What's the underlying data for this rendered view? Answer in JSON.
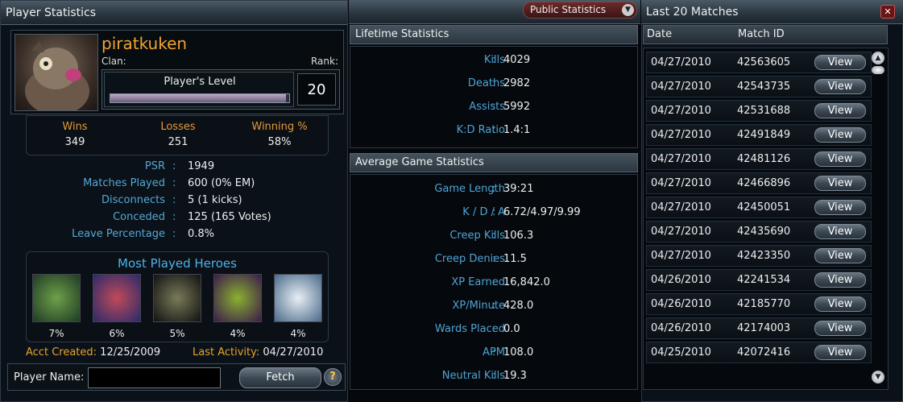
{
  "window": {
    "left_title": "Player Statistics",
    "right_title": "Last 20 Matches",
    "view_dropdown": "Public Statistics"
  },
  "player": {
    "name": "piratkuken",
    "clan_label": "Clan:",
    "rank_label": "Rank:",
    "level_label": "Player's Level",
    "level": "20",
    "level_progress": 0.98,
    "wins_label": "Wins",
    "wins": "349",
    "losses_label": "Losses",
    "losses": "251",
    "winpct_label": "Winning %",
    "winpct": "58%"
  },
  "stats": [
    {
      "label": "PSR",
      "value": "1949"
    },
    {
      "label": "Matches Played",
      "value": "600 (0% EM)"
    },
    {
      "label": "Disconnects",
      "value": "5 (1 kicks)"
    },
    {
      "label": "Conceded",
      "value": "125 (165 Votes)"
    },
    {
      "label": "Leave Percentage",
      "value": "0.8%"
    }
  ],
  "heroes": {
    "title": "Most Played Heroes",
    "items": [
      {
        "icon": "goblin-hero-portrait",
        "pct": "7%"
      },
      {
        "icon": "vampire-hero-portrait",
        "pct": "6%"
      },
      {
        "icon": "undead-hero-portrait",
        "pct": "5%"
      },
      {
        "icon": "beast-hero-portrait",
        "pct": "4%"
      },
      {
        "icon": "frost-hero-portrait",
        "pct": "4%"
      }
    ]
  },
  "account": {
    "created_label": "Acct Created:",
    "created": "12/25/2009",
    "activity_label": "Last Activity:",
    "activity": "04/27/2010"
  },
  "search": {
    "label": "Player Name:",
    "value": "",
    "fetch": "Fetch",
    "help": "?"
  },
  "lifetime": {
    "title": "Lifetime Statistics",
    "rows": [
      {
        "label": "Kills",
        "value": "4029"
      },
      {
        "label": "Deaths",
        "value": "2982"
      },
      {
        "label": "Assists",
        "value": "5992"
      },
      {
        "label": "K:D Ratio",
        "value": "1.4:1"
      }
    ]
  },
  "average": {
    "title": "Average Game Statistics",
    "rows": [
      {
        "label": "Game Length",
        "value": "39:21"
      },
      {
        "label": "K / D / A",
        "value": "6.72/4.97/9.99"
      },
      {
        "label": "Creep Kills",
        "value": "106.3"
      },
      {
        "label": "Creep Denies",
        "value": "11.5"
      },
      {
        "label": "XP Earned",
        "value": "16,842.0"
      },
      {
        "label": "XP/Minute",
        "value": "428.0"
      },
      {
        "label": "Wards Placed",
        "value": "0.0"
      },
      {
        "label": "APM",
        "value": "108.0"
      },
      {
        "label": "Neutral Kills",
        "value": "19.3"
      }
    ]
  },
  "matches": {
    "date_header": "Date",
    "id_header": "Match ID",
    "view_label": "View",
    "rows": [
      {
        "date": "04/27/2010",
        "id": "42563605"
      },
      {
        "date": "04/27/2010",
        "id": "42543735"
      },
      {
        "date": "04/27/2010",
        "id": "42531688"
      },
      {
        "date": "04/27/2010",
        "id": "42491849"
      },
      {
        "date": "04/27/2010",
        "id": "42481126"
      },
      {
        "date": "04/27/2010",
        "id": "42466896"
      },
      {
        "date": "04/27/2010",
        "id": "42450051"
      },
      {
        "date": "04/27/2010",
        "id": "42435690"
      },
      {
        "date": "04/27/2010",
        "id": "42423350"
      },
      {
        "date": "04/26/2010",
        "id": "42241534"
      },
      {
        "date": "04/26/2010",
        "id": "42185770"
      },
      {
        "date": "04/26/2010",
        "id": "42174003"
      },
      {
        "date": "04/25/2010",
        "id": "42072416"
      }
    ]
  },
  "colors": {
    "label_blue": "#56a7d6",
    "orange": "#f3a32f"
  }
}
